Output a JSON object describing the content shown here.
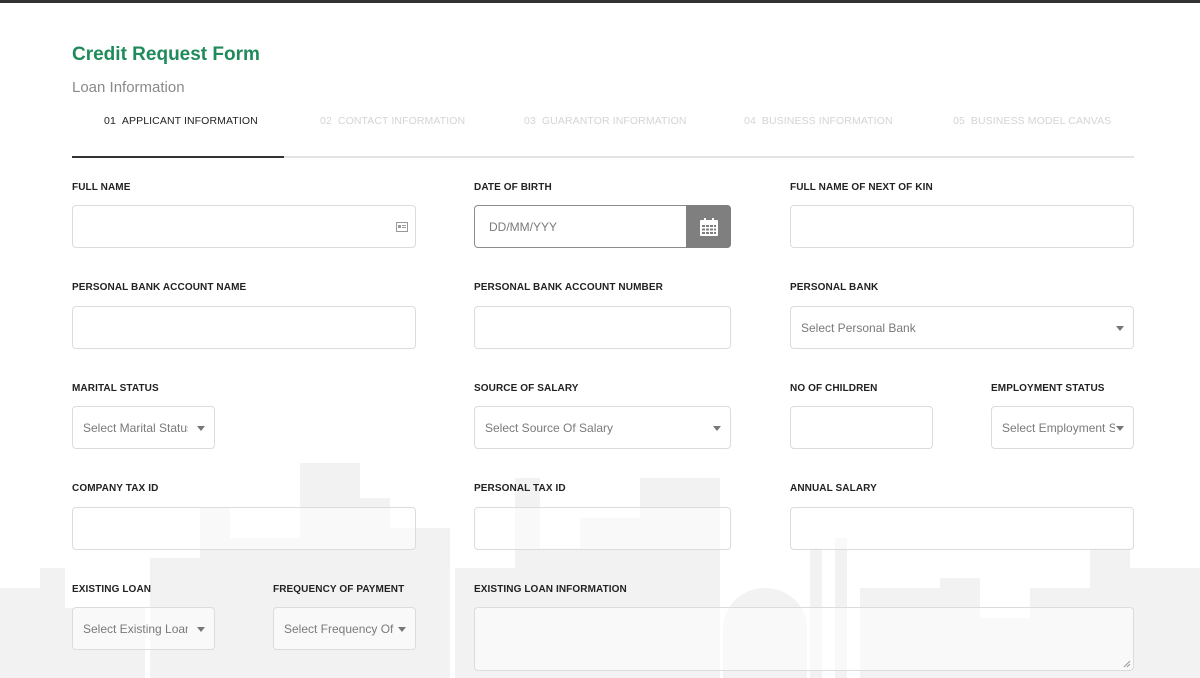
{
  "form": {
    "title": "Credit Request Form",
    "subtitle": "Loan Information"
  },
  "tabs": [
    {
      "num": "01",
      "label": "APPLICANT INFORMATION",
      "active": true
    },
    {
      "num": "02",
      "label": "CONTACT INFORMATION",
      "active": false
    },
    {
      "num": "03",
      "label": "GUARANTOR INFORMATION",
      "active": false
    },
    {
      "num": "04",
      "label": "BUSINESS INFORMATION",
      "active": false
    },
    {
      "num": "05",
      "label": "BUSINESS MODEL CANVAS",
      "active": false
    }
  ],
  "fields": {
    "full_name": {
      "label": "FULL NAME",
      "value": "",
      "icon": "id-card-icon"
    },
    "date_of_birth": {
      "label": "DATE OF BIRTH",
      "placeholder": "DD/MM/YYY",
      "icon": "calendar-icon"
    },
    "next_of_kin": {
      "label": "FULL NAME OF NEXT OF KIN",
      "value": ""
    },
    "bank_account_name": {
      "label": "PERSONAL BANK ACCOUNT NAME",
      "value": ""
    },
    "bank_account_number": {
      "label": "PERSONAL BANK ACCOUNT NUMBER",
      "value": ""
    },
    "personal_bank": {
      "label": "PERSONAL BANK",
      "placeholder": "Select Personal Bank"
    },
    "marital_status": {
      "label": "MARITAL STATUS",
      "placeholder": "Select Marital Status"
    },
    "source_of_salary": {
      "label": "SOURCE OF SALARY",
      "placeholder": "Select Source Of Salary"
    },
    "no_of_children": {
      "label": "NO OF CHILDREN",
      "value": ""
    },
    "employment_status": {
      "label": "EMPLOYMENT STATUS",
      "placeholder": "Select Employment Status"
    },
    "company_tax_id": {
      "label": "COMPANY TAX ID",
      "value": ""
    },
    "personal_tax_id": {
      "label": "PERSONAL TAX ID",
      "value": ""
    },
    "annual_salary": {
      "label": "ANNUAL SALARY",
      "value": ""
    },
    "existing_loan": {
      "label": "EXISTING LOAN",
      "placeholder": "Select Existing Loan"
    },
    "frequency_of_payment": {
      "label": "FREQUENCY OF PAYMENT",
      "placeholder": "Select Frequency Of Payment"
    },
    "existing_loan_information": {
      "label": "EXISTING LOAN INFORMATION",
      "value": ""
    }
  },
  "colors": {
    "title_green": "#1f8a5a",
    "calendar_button": "#7f7f7f",
    "inactive_tab": "#d4d4d4"
  }
}
